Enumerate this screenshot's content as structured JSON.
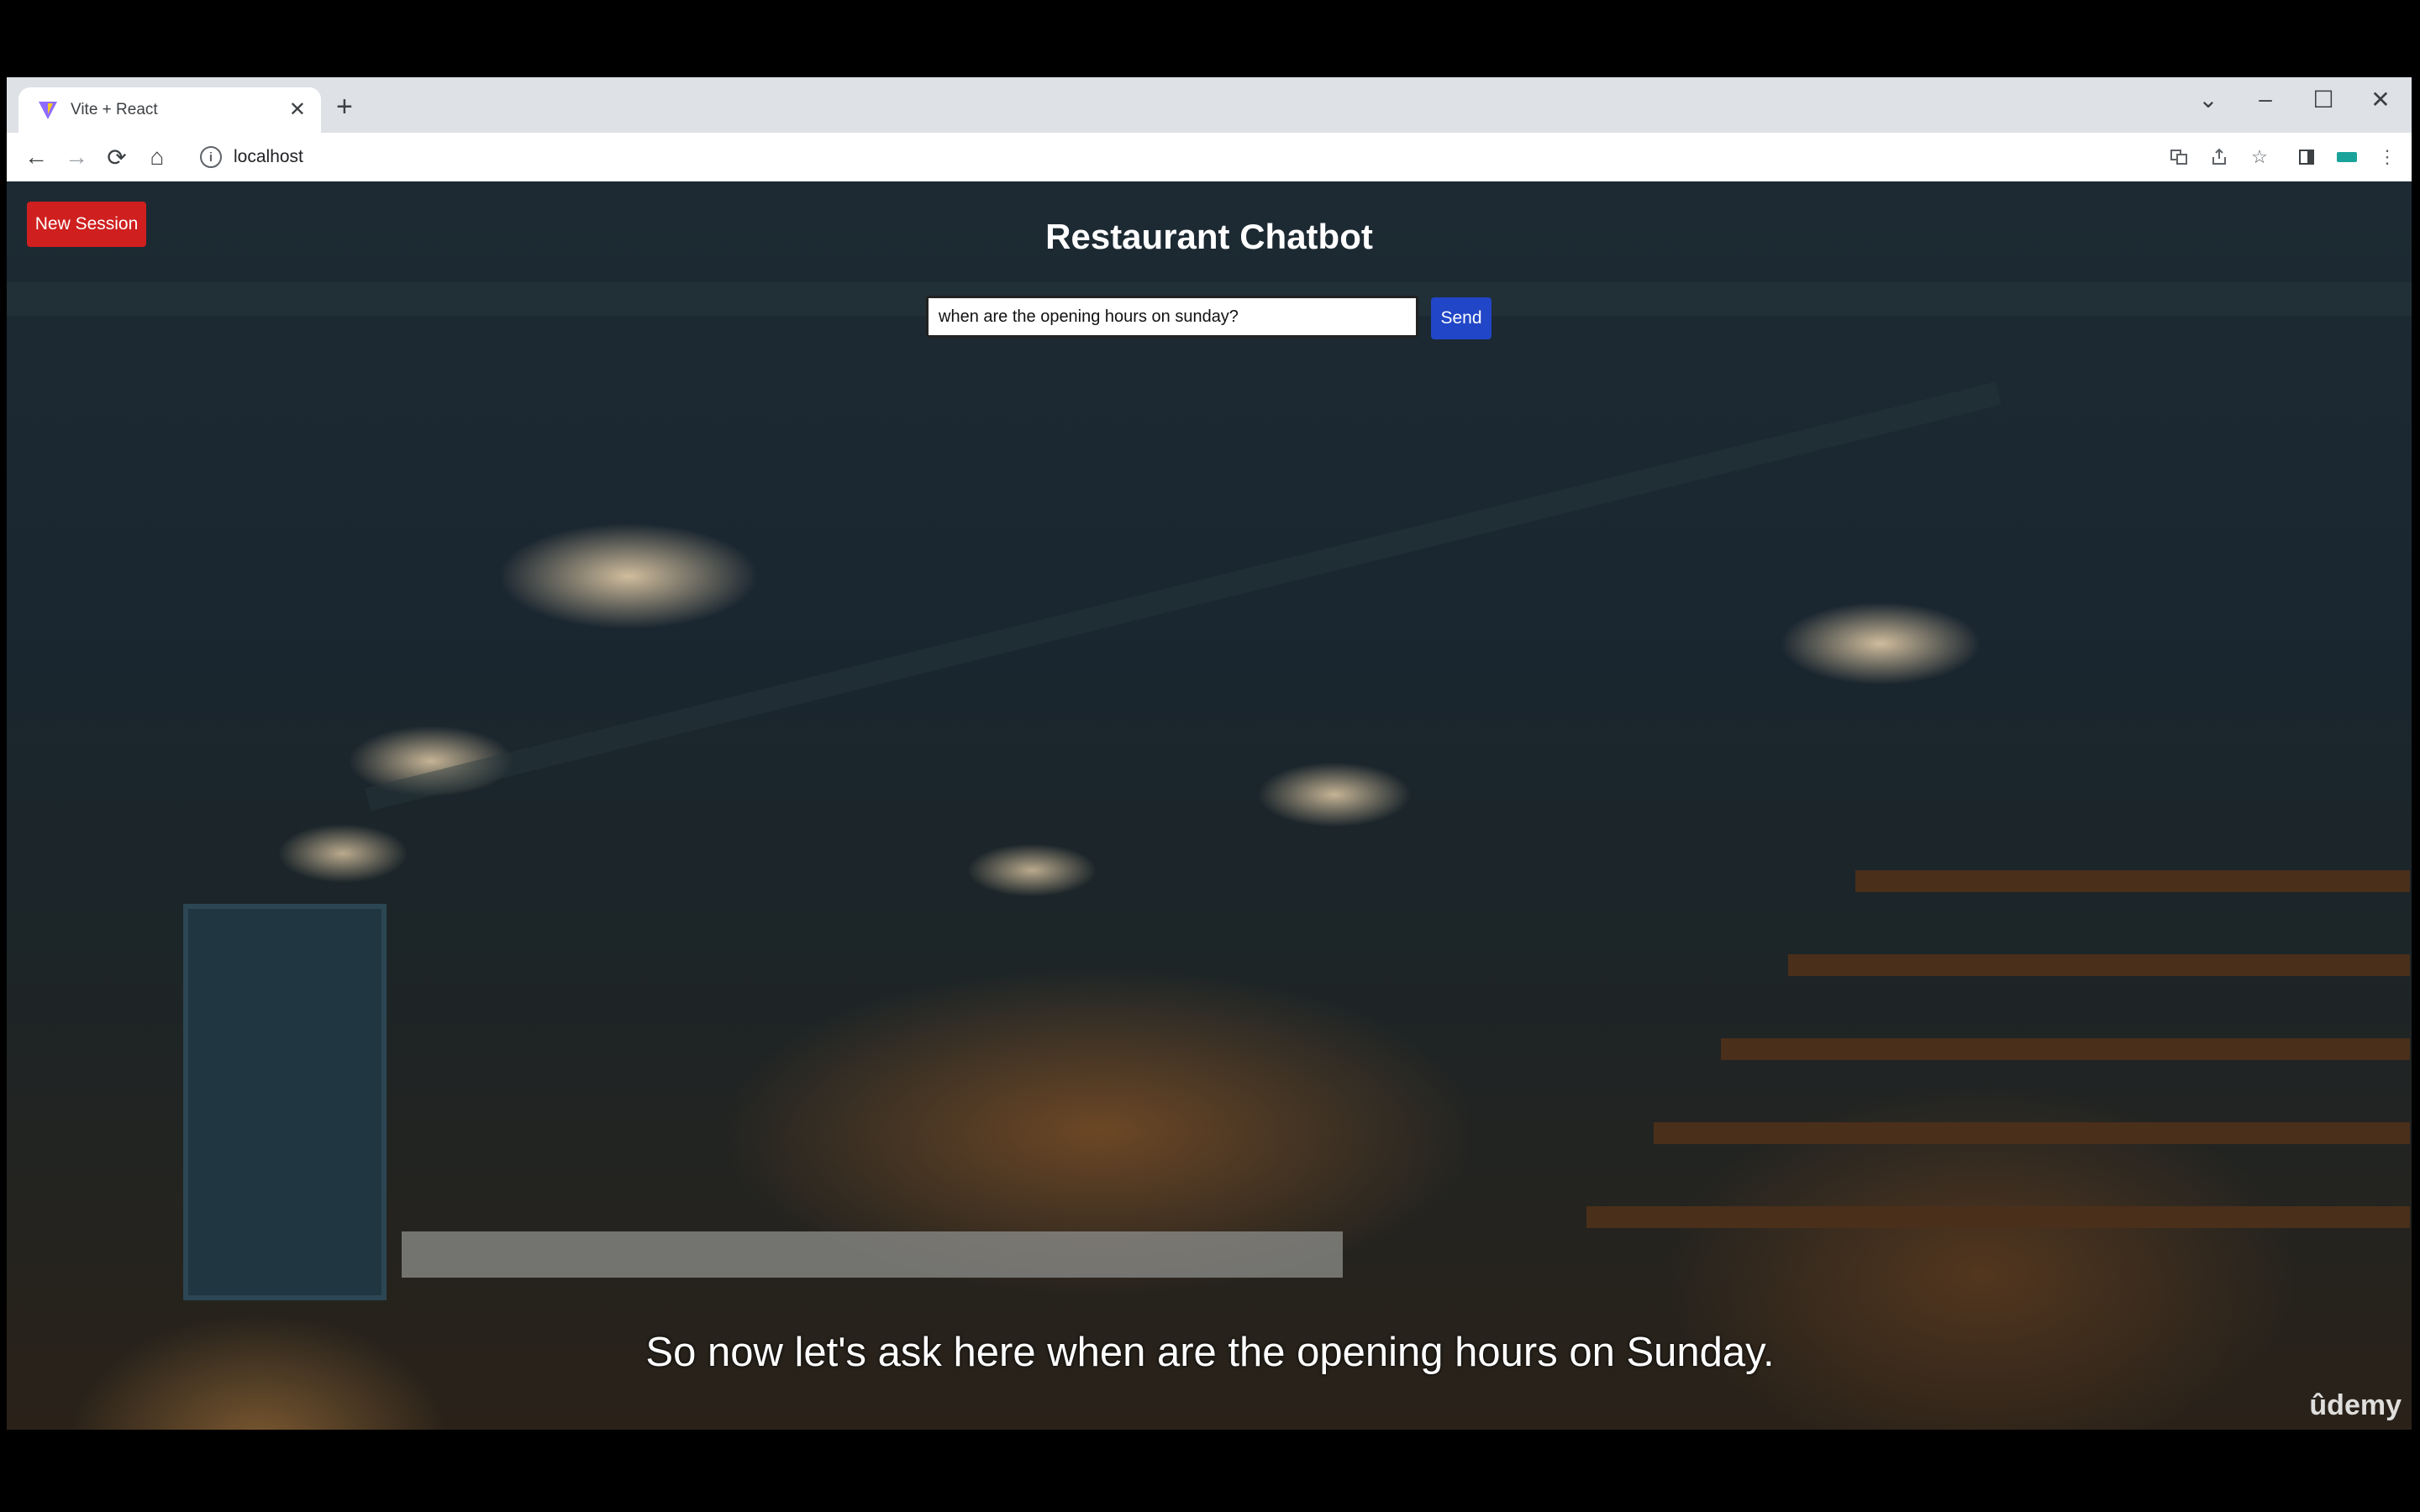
{
  "browser": {
    "tab_title": "Vite + React",
    "new_tab_label": "+",
    "url": "localhost",
    "nav": {
      "back": "←",
      "forward": "→",
      "reload": "⟳",
      "home": "⌂"
    },
    "window_controls": {
      "tab_search": "⌄",
      "minimize": "–",
      "maximize": "☐",
      "close": "✕"
    }
  },
  "app": {
    "new_session_label": "New Session",
    "title": "Restaurant Chatbot",
    "input_value": "when are the opening hours on sunday?",
    "send_label": "Send"
  },
  "caption": "So now let's ask here when are the opening hours on Sunday.",
  "watermark": "ûdemy",
  "colors": {
    "new_session_bg": "#cf1f1f",
    "send_bg": "#2146c7",
    "title_text": "#ffffff"
  }
}
